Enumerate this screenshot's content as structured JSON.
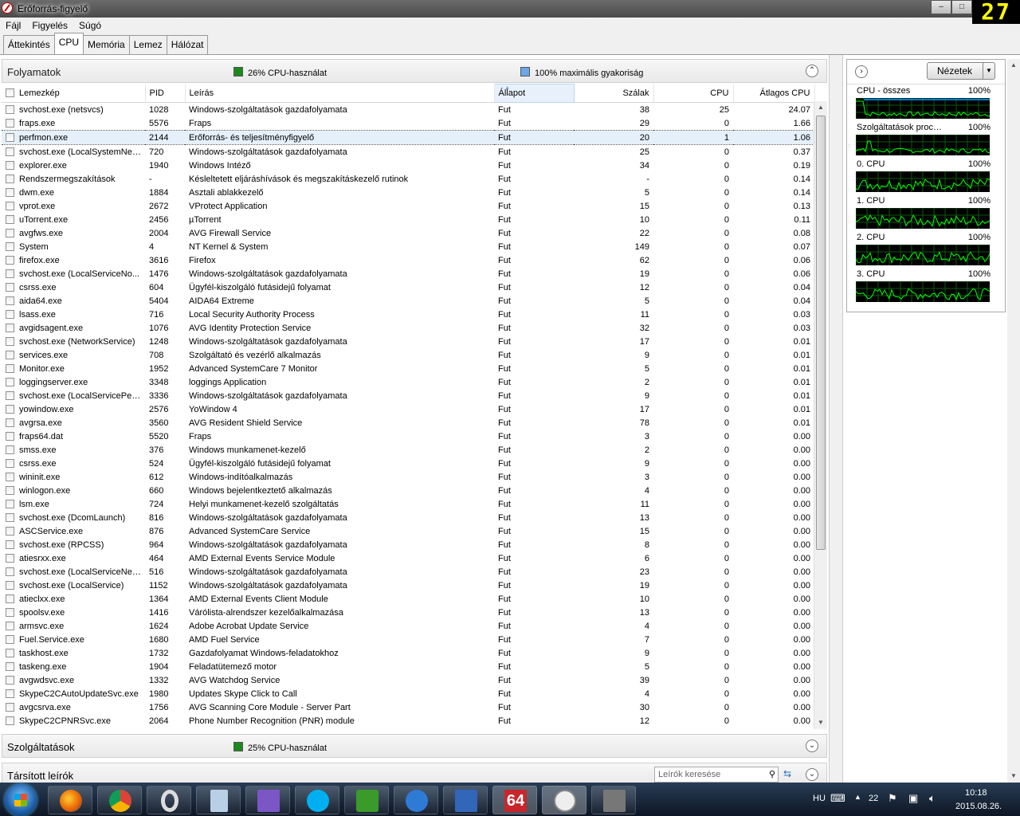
{
  "window": {
    "title": "Erőforrás-figyelő",
    "fps": "27",
    "btn_min": "–",
    "btn_max": "□"
  },
  "menu": [
    "Fájl",
    "Figyelés",
    "Súgó"
  ],
  "tabs": [
    "Áttekintés",
    "CPU",
    "Memória",
    "Lemez",
    "Hálózat"
  ],
  "processes": {
    "title": "Folyamatok",
    "cpu_usage": "26% CPU-használat",
    "max_freq": "100% maximális gyakoriság",
    "columns": [
      "Lemezkép",
      "PID",
      "Leírás",
      "Állapot",
      "Szálak",
      "CPU",
      "Átlagos CPU"
    ],
    "rows": [
      [
        "svchost.exe (netsvcs)",
        "1028",
        "Windows-szolgáltatások gazdafolyamata",
        "Fut",
        "38",
        "25",
        "24.07"
      ],
      [
        "fraps.exe",
        "5576",
        "Fraps",
        "Fut",
        "29",
        "0",
        "1.66"
      ],
      [
        "perfmon.exe",
        "2144",
        "Erőforrás- és teljesítményfigyelő",
        "Fut",
        "20",
        "1",
        "1.06"
      ],
      [
        "svchost.exe (LocalSystemNet...",
        "720",
        "Windows-szolgáltatások gazdafolyamata",
        "Fut",
        "25",
        "0",
        "0.37"
      ],
      [
        "explorer.exe",
        "1940",
        "Windows Intéző",
        "Fut",
        "34",
        "0",
        "0.19"
      ],
      [
        "Rendszermegszakítások",
        "-",
        "Késleltetett eljáráshívások és megszakításkezelő rutinok",
        "Fut",
        "-",
        "0",
        "0.14"
      ],
      [
        "dwm.exe",
        "1884",
        "Asztali ablakkezelő",
        "Fut",
        "5",
        "0",
        "0.14"
      ],
      [
        "vprot.exe",
        "2672",
        "VProtect Application",
        "Fut",
        "15",
        "0",
        "0.13"
      ],
      [
        "uTorrent.exe",
        "2456",
        "µTorrent",
        "Fut",
        "10",
        "0",
        "0.11"
      ],
      [
        "avgfws.exe",
        "2004",
        "AVG Firewall Service",
        "Fut",
        "22",
        "0",
        "0.08"
      ],
      [
        "System",
        "4",
        "NT Kernel & System",
        "Fut",
        "149",
        "0",
        "0.07"
      ],
      [
        "firefox.exe",
        "3616",
        "Firefox",
        "Fut",
        "62",
        "0",
        "0.06"
      ],
      [
        "svchost.exe (LocalServiceNo...",
        "1476",
        "Windows-szolgáltatások gazdafolyamata",
        "Fut",
        "19",
        "0",
        "0.06"
      ],
      [
        "csrss.exe",
        "604",
        "Ügyfél-kiszolgáló futásidejű folyamat",
        "Fut",
        "12",
        "0",
        "0.04"
      ],
      [
        "aida64.exe",
        "5404",
        "AIDA64 Extreme",
        "Fut",
        "5",
        "0",
        "0.04"
      ],
      [
        "lsass.exe",
        "716",
        "Local Security Authority Process",
        "Fut",
        "11",
        "0",
        "0.03"
      ],
      [
        "avgidsagent.exe",
        "1076",
        "AVG Identity Protection Service",
        "Fut",
        "32",
        "0",
        "0.03"
      ],
      [
        "svchost.exe (NetworkService)",
        "1248",
        "Windows-szolgáltatások gazdafolyamata",
        "Fut",
        "17",
        "0",
        "0.01"
      ],
      [
        "services.exe",
        "708",
        "Szolgáltató és vezérlő alkalmazás",
        "Fut",
        "9",
        "0",
        "0.01"
      ],
      [
        "Monitor.exe",
        "1952",
        "Advanced SystemCare 7 Monitor",
        "Fut",
        "5",
        "0",
        "0.01"
      ],
      [
        "loggingserver.exe",
        "3348",
        "loggings Application",
        "Fut",
        "2",
        "0",
        "0.01"
      ],
      [
        "svchost.exe (LocalServicePee...",
        "3336",
        "Windows-szolgáltatások gazdafolyamata",
        "Fut",
        "9",
        "0",
        "0.01"
      ],
      [
        "yowindow.exe",
        "2576",
        "YoWindow 4",
        "Fut",
        "17",
        "0",
        "0.01"
      ],
      [
        "avgrsa.exe",
        "3560",
        "AVG Resident Shield Service",
        "Fut",
        "78",
        "0",
        "0.01"
      ],
      [
        "fraps64.dat",
        "5520",
        "Fraps",
        "Fut",
        "3",
        "0",
        "0.00"
      ],
      [
        "smss.exe",
        "376",
        "Windows munkamenet-kezelő",
        "Fut",
        "2",
        "0",
        "0.00"
      ],
      [
        "csrss.exe",
        "524",
        "Ügyfél-kiszolgáló futásidejű folyamat",
        "Fut",
        "9",
        "0",
        "0.00"
      ],
      [
        "wininit.exe",
        "612",
        "Windows-indítóalkalmazás",
        "Fut",
        "3",
        "0",
        "0.00"
      ],
      [
        "winlogon.exe",
        "660",
        "Windows bejelentkeztető alkalmazás",
        "Fut",
        "4",
        "0",
        "0.00"
      ],
      [
        "lsm.exe",
        "724",
        "Helyi munkamenet-kezelő szolgáltatás",
        "Fut",
        "11",
        "0",
        "0.00"
      ],
      [
        "svchost.exe (DcomLaunch)",
        "816",
        "Windows-szolgáltatások gazdafolyamata",
        "Fut",
        "13",
        "0",
        "0.00"
      ],
      [
        "ASCService.exe",
        "876",
        "Advanced SystemCare Service",
        "Fut",
        "15",
        "0",
        "0.00"
      ],
      [
        "svchost.exe (RPCSS)",
        "964",
        "Windows-szolgáltatások gazdafolyamata",
        "Fut",
        "8",
        "0",
        "0.00"
      ],
      [
        "atiesrxx.exe",
        "464",
        "AMD External Events Service Module",
        "Fut",
        "6",
        "0",
        "0.00"
      ],
      [
        "svchost.exe (LocalServiceNet...",
        "516",
        "Windows-szolgáltatások gazdafolyamata",
        "Fut",
        "23",
        "0",
        "0.00"
      ],
      [
        "svchost.exe (LocalService)",
        "1152",
        "Windows-szolgáltatások gazdafolyamata",
        "Fut",
        "19",
        "0",
        "0.00"
      ],
      [
        "atieclxx.exe",
        "1364",
        "AMD External Events Client Module",
        "Fut",
        "10",
        "0",
        "0.00"
      ],
      [
        "spoolsv.exe",
        "1416",
        "Várólista-alrendszer kezelőalkalmazása",
        "Fut",
        "13",
        "0",
        "0.00"
      ],
      [
        "armsvc.exe",
        "1624",
        "Adobe Acrobat Update Service",
        "Fut",
        "4",
        "0",
        "0.00"
      ],
      [
        "Fuel.Service.exe",
        "1680",
        "AMD Fuel Service",
        "Fut",
        "7",
        "0",
        "0.00"
      ],
      [
        "taskhost.exe",
        "1732",
        "Gazdafolyamat Windows-feladatokhoz",
        "Fut",
        "9",
        "0",
        "0.00"
      ],
      [
        "taskeng.exe",
        "1904",
        "Feladatütemező motor",
        "Fut",
        "5",
        "0",
        "0.00"
      ],
      [
        "avgwdsvc.exe",
        "1332",
        "AVG Watchdog Service",
        "Fut",
        "39",
        "0",
        "0.00"
      ],
      [
        "SkypeC2CAutoUpdateSvc.exe",
        "1980",
        "Updates Skype Click to Call",
        "Fut",
        "4",
        "0",
        "0.00"
      ],
      [
        "avgcsrva.exe",
        "1756",
        "AVG Scanning Core Module - Server Part",
        "Fut",
        "30",
        "0",
        "0.00"
      ],
      [
        "SkypeC2CPNRSvc.exe",
        "2064",
        "Phone Number Recognition (PNR) module",
        "Fut",
        "12",
        "0",
        "0.00"
      ]
    ]
  },
  "services": {
    "title": "Szolgáltatások",
    "cpu_usage": "25% CPU-használat"
  },
  "handles": {
    "title": "Társított leírók",
    "search_placeholder": "Leírók keresése"
  },
  "right_panel": {
    "views_label": "Nézetek",
    "graphs": [
      {
        "label": "CPU - összes",
        "pct": "100%"
      },
      {
        "label": "Szolgáltatások processz...",
        "pct": "100%"
      },
      {
        "label": "0. CPU",
        "pct": "100%"
      },
      {
        "label": "1. CPU",
        "pct": "100%"
      },
      {
        "label": "2. CPU",
        "pct": "100%"
      },
      {
        "label": "3. CPU",
        "pct": "100%"
      }
    ]
  },
  "tray": {
    "lang": "HU",
    "temp": "22",
    "time": "10:18",
    "date": "2015.08.26."
  },
  "taskbar_icon_64": "64",
  "colors": {
    "graph_bg": "#000000",
    "graph_line": "#00ff00",
    "accent_blue": "#0078d7"
  }
}
